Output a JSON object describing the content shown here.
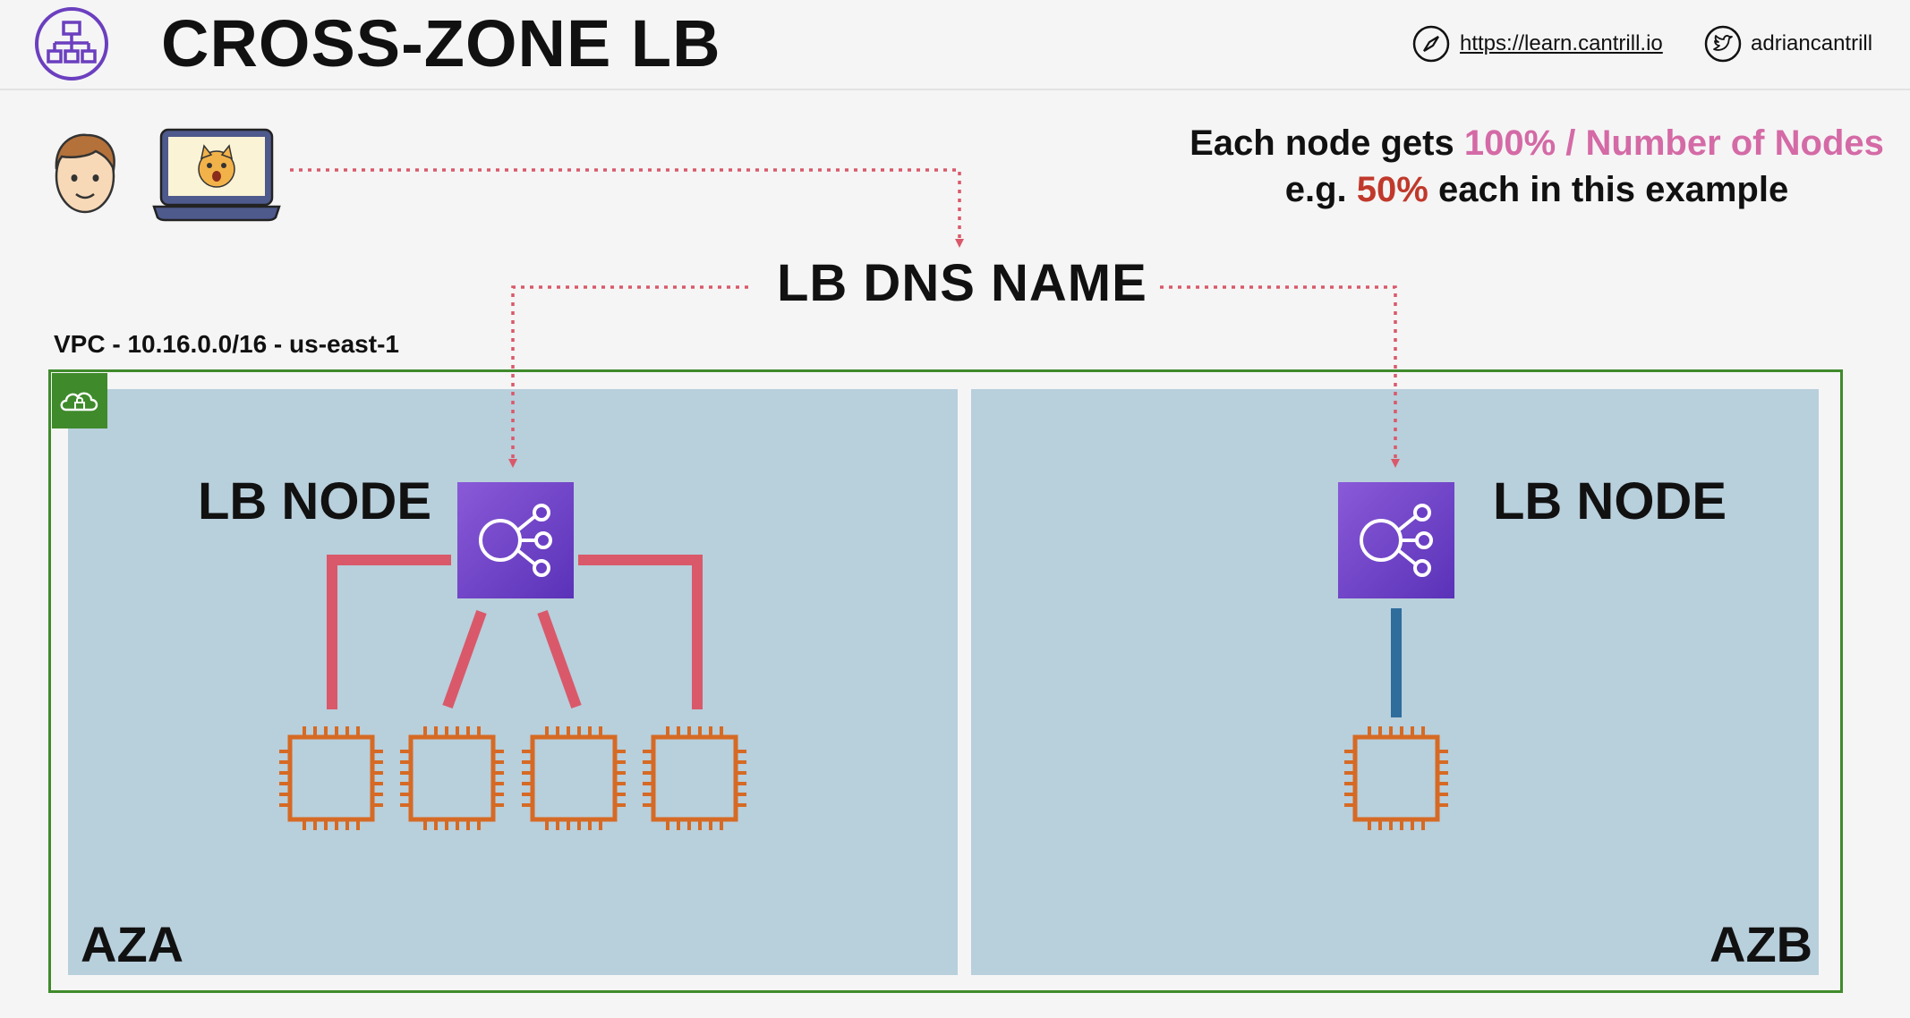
{
  "header": {
    "title": "CROSS-ZONE LB",
    "url_link": "https://learn.cantrill.io",
    "twitter_handle": "adriancantrill",
    "logo_icon": "load-balancer-hierarchy-icon",
    "url_icon": "compass-icon",
    "twitter_icon": "twitter-bird-icon"
  },
  "note": {
    "line1_prefix": "Each node gets ",
    "line1_highlight": "100% / Number of Nodes",
    "line2_prefix": "e.g. ",
    "line2_highlight": "50%",
    "line2_suffix": " each in this example"
  },
  "diagram": {
    "dns_label": "LB DNS NAME",
    "vpc_label": "VPC - 10.16.0.0/16 - us-east-1",
    "vpc_icon": "vpc-cloud-lock-icon",
    "client_icons": [
      "user-face-icon",
      "laptop-cat-icon"
    ],
    "zones": [
      {
        "label": "AZA",
        "lb_node_label": "LB NODE",
        "instance_count": 4,
        "link_color": "#d9596a"
      },
      {
        "label": "AZB",
        "lb_node_label": "LB NODE",
        "instance_count": 1,
        "link_color": "#2e6d9c"
      }
    ]
  },
  "colors": {
    "accent_pink": "#d46aa6",
    "accent_red": "#c0392b",
    "dotted_arrow": "#d9596a",
    "az_fill": "#b8cfdc",
    "vpc_border": "#3f8a2b",
    "lb_node_purple": "#6a3fc6",
    "instance_orange": "#d66a24"
  }
}
